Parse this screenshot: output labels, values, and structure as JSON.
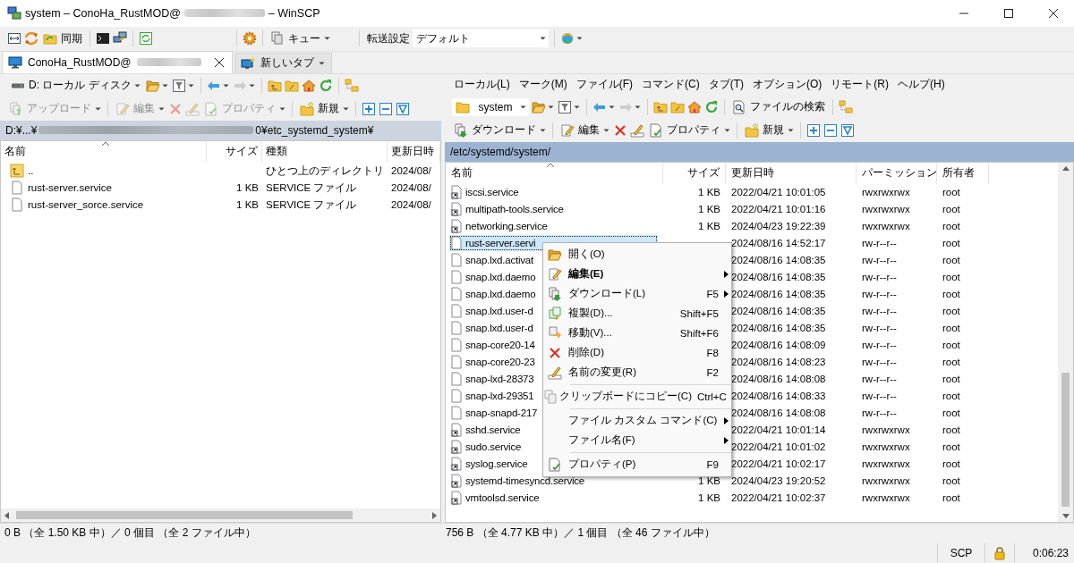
{
  "window": {
    "title_prefix": "system – ConoHa_RustMOD@",
    "title_suffix": "– WinSCP"
  },
  "toolbar": {
    "sync": "同期",
    "queue": "キュー",
    "transfer_label": "転送設定",
    "transfer_value": "デフォルト"
  },
  "tabs": [
    {
      "label": "ConoHa_RustMOD@",
      "selected": true,
      "closable": true
    },
    {
      "label": "新しいタブ",
      "selected": false,
      "closable": false
    }
  ],
  "local": {
    "drive": "D: ローカル ディスク",
    "forward_disabled": true,
    "file_actions_disabled": true,
    "actions": {
      "transfer": "アップロード",
      "edit": "編集",
      "properties": "プロパティ",
      "new": "新規"
    },
    "path_start": "D:¥...¥",
    "path_end": "0¥etc_systemd_system¥",
    "path_active": false,
    "columns": [
      "名前",
      "サイズ",
      "種類",
      "更新日時"
    ],
    "rows": [
      {
        "kind": "parent",
        "name": "..",
        "type": "ひとつ上のディレクトリ",
        "modified": "2024/08/",
        "selected": false
      },
      {
        "kind": "file",
        "name": "rust-server.service",
        "size": "1 KB",
        "type": "SERVICE ファイル",
        "modified": "2024/08/",
        "selected": false
      },
      {
        "kind": "file",
        "name": "rust-server_sorce.service",
        "size": "1 KB",
        "type": "SERVICE ファイル",
        "modified": "2024/08/",
        "selected": false
      }
    ]
  },
  "remote": {
    "menu": [
      "ローカル(L)",
      "マーク(M)",
      "ファイル(F)",
      "コマンド(C)",
      "タブ(T)",
      "オプション(O)",
      "リモート(R)",
      "ヘルプ(H)"
    ],
    "directory": "system",
    "find": "ファイルの検索",
    "forward_disabled": true,
    "file_actions_disabled": false,
    "actions": {
      "transfer": "ダウンロード",
      "edit": "編集",
      "properties": "プロパティ",
      "new": "新規"
    },
    "path": "/etc/systemd/system/",
    "path_active": true,
    "columns": [
      "名前",
      "サイズ",
      "更新日時",
      "パーミッション",
      "所有者"
    ],
    "rows": [
      {
        "kind": "link",
        "name": "iscsi.service",
        "size": "1 KB",
        "modified": "2022/04/21 10:01:05",
        "permissions": "rwxrwxrwx",
        "owner": "root",
        "selected": false
      },
      {
        "kind": "link",
        "name": "multipath-tools.service",
        "size": "1 KB",
        "modified": "2022/04/21 10:01:16",
        "permissions": "rwxrwxrwx",
        "owner": "root",
        "selected": false
      },
      {
        "kind": "link",
        "name": "networking.service",
        "size": "1 KB",
        "modified": "2024/04/23 19:22:39",
        "permissions": "rwxrwxrwx",
        "owner": "root",
        "selected": false
      },
      {
        "kind": "file",
        "name": "rust-server.servi",
        "modified": "2024/08/16 14:52:17",
        "permissions": "rw-r--r--",
        "owner": "root",
        "selected": true
      },
      {
        "kind": "file",
        "name": "snap.lxd.activat",
        "modified": "2024/08/16 14:08:35",
        "permissions": "rw-r--r--",
        "owner": "root",
        "selected": false
      },
      {
        "kind": "file",
        "name": "snap.lxd.daemo",
        "modified": "2024/08/16 14:08:35",
        "permissions": "rw-r--r--",
        "owner": "root",
        "selected": false
      },
      {
        "kind": "file",
        "name": "snap.lxd.daemo",
        "modified": "2024/08/16 14:08:35",
        "permissions": "rw-r--r--",
        "owner": "root",
        "selected": false
      },
      {
        "kind": "file",
        "name": "snap.lxd.user-d",
        "modified": "2024/08/16 14:08:35",
        "permissions": "rw-r--r--",
        "owner": "root",
        "selected": false
      },
      {
        "kind": "file",
        "name": "snap.lxd.user-d",
        "modified": "2024/08/16 14:08:35",
        "permissions": "rw-r--r--",
        "owner": "root",
        "selected": false
      },
      {
        "kind": "file",
        "name": "snap-core20-14",
        "modified": "2024/08/16 14:08:09",
        "permissions": "rw-r--r--",
        "owner": "root",
        "selected": false
      },
      {
        "kind": "file",
        "name": "snap-core20-23",
        "modified": "2024/08/16 14:08:23",
        "permissions": "rw-r--r--",
        "owner": "root",
        "selected": false
      },
      {
        "kind": "file",
        "name": "snap-lxd-28373",
        "modified": "2024/08/16 14:08:08",
        "permissions": "rw-r--r--",
        "owner": "root",
        "selected": false
      },
      {
        "kind": "file",
        "name": "snap-lxd-29351",
        "modified": "2024/08/16 14:08:33",
        "permissions": "rw-r--r--",
        "owner": "root",
        "selected": false
      },
      {
        "kind": "file",
        "name": "snap-snapd-217",
        "modified": "2024/08/16 14:08:08",
        "permissions": "rw-r--r--",
        "owner": "root",
        "selected": false
      },
      {
        "kind": "link",
        "name": "sshd.service",
        "modified": "2022/04/21 10:01:14",
        "permissions": "rwxrwxrwx",
        "owner": "root",
        "selected": false
      },
      {
        "kind": "link",
        "name": "sudo.service",
        "modified": "2022/04/21 10:01:02",
        "permissions": "rwxrwxrwx",
        "owner": "root",
        "selected": false
      },
      {
        "kind": "link",
        "name": "syslog.service",
        "modified": "2022/04/21 10:02:17",
        "permissions": "rwxrwxrwx",
        "owner": "root",
        "selected": false
      },
      {
        "kind": "link",
        "name": "systemd-timesyncd.service",
        "size": "1 KB",
        "modified": "2024/04/23 19:20:52",
        "permissions": "rwxrwxrwx",
        "owner": "root",
        "selected": false
      },
      {
        "kind": "link",
        "name": "vmtoolsd.service",
        "size": "1 KB",
        "modified": "2022/04/21 10:02:37",
        "permissions": "rwxrwxrwx",
        "owner": "root",
        "selected": false
      }
    ]
  },
  "context_menu": [
    {
      "kind": "item",
      "label": "開く(O)",
      "default": false,
      "submenu": false
    },
    {
      "kind": "item",
      "label": "編集(E)",
      "default": true,
      "submenu": true
    },
    {
      "kind": "item",
      "label": "ダウンロード(L)",
      "shortcut": "F5",
      "default": false,
      "submenu": true
    },
    {
      "kind": "item",
      "label": "複製(D)...",
      "shortcut": "Shift+F5",
      "default": false,
      "submenu": false
    },
    {
      "kind": "item",
      "label": "移動(V)...",
      "shortcut": "Shift+F6",
      "default": false,
      "submenu": false
    },
    {
      "kind": "item",
      "label": "削除(D)",
      "shortcut": "F8",
      "default": false,
      "submenu": false
    },
    {
      "kind": "item",
      "label": "名前の変更(R)",
      "shortcut": "F2",
      "default": false,
      "submenu": false
    },
    {
      "kind": "separator"
    },
    {
      "kind": "item",
      "label": "クリップボードにコピー(C)",
      "shortcut": "Ctrl+C",
      "default": false,
      "submenu": false
    },
    {
      "kind": "separator"
    },
    {
      "kind": "item",
      "label": "ファイル カスタム コマンド(C)",
      "default": false,
      "submenu": true
    },
    {
      "kind": "item",
      "label": "ファイル名(F)",
      "default": false,
      "submenu": true
    },
    {
      "kind": "separator"
    },
    {
      "kind": "item",
      "label": "プロパティ(P)",
      "shortcut": "F9",
      "default": false,
      "submenu": false
    }
  ],
  "status_bar": {
    "local": "0 B （全 1.50 KB 中）／ 0 個目 （全 2 ファイル中）",
    "remote": "756 B （全 4.77 KB 中）／ 1 個目 （全 46 ファイル中）",
    "protocol": "SCP",
    "elapsed": "0:06:23"
  }
}
